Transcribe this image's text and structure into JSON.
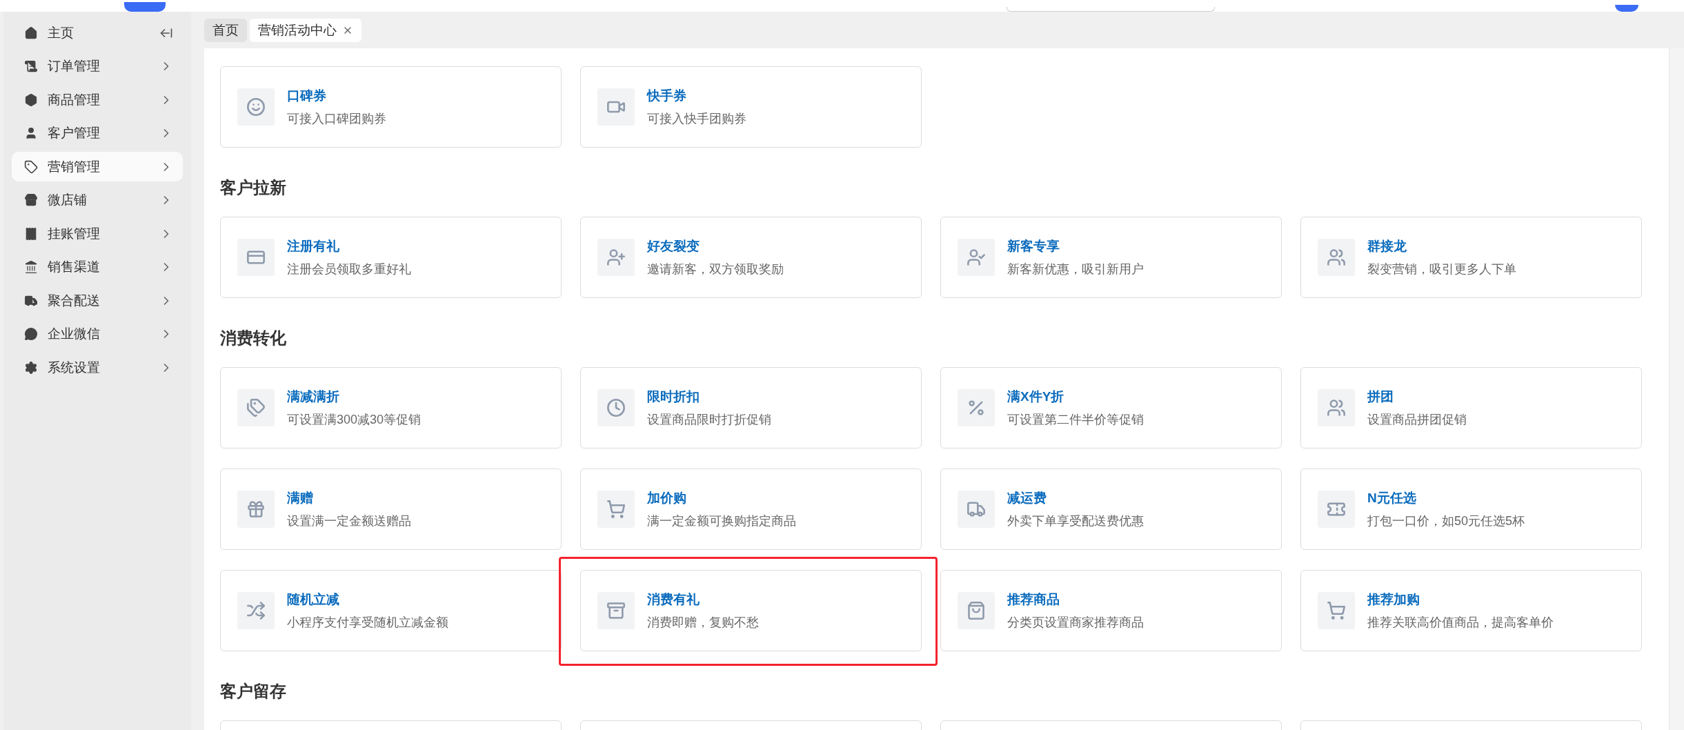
{
  "sidebar": {
    "items": [
      {
        "label": "主页",
        "selected": false,
        "kind": "home"
      },
      {
        "label": "订单管理",
        "selected": false,
        "kind": "menu"
      },
      {
        "label": "商品管理",
        "selected": false,
        "kind": "menu"
      },
      {
        "label": "客户管理",
        "selected": false,
        "kind": "menu"
      },
      {
        "label": "营销管理",
        "selected": true,
        "kind": "menu"
      },
      {
        "label": "微店铺",
        "selected": false,
        "kind": "menu"
      },
      {
        "label": "挂账管理",
        "selected": false,
        "kind": "menu"
      },
      {
        "label": "销售渠道",
        "selected": false,
        "kind": "menu"
      },
      {
        "label": "聚合配送",
        "selected": false,
        "kind": "menu"
      },
      {
        "label": "企业微信",
        "selected": false,
        "kind": "menu"
      },
      {
        "label": "系统设置",
        "selected": false,
        "kind": "menu"
      }
    ]
  },
  "tabs": [
    {
      "label": "首页",
      "selected": false,
      "closable": false
    },
    {
      "label": "营销活动中心",
      "selected": true,
      "closable": true
    }
  ],
  "sections": [
    {
      "cards": [
        {
          "title": "口碑券",
          "description": "可接入口碑团购券"
        },
        {
          "title": "快手券",
          "description": "可接入快手团购券"
        }
      ]
    },
    {
      "title": "客户拉新",
      "cards": [
        {
          "title": "注册有礼",
          "description": "注册会员领取多重好礼"
        },
        {
          "title": "好友裂变",
          "description": "邀请新客，双方领取奖励"
        },
        {
          "title": "新客专享",
          "description": "新客新优惠，吸引新用户"
        },
        {
          "title": "群接龙",
          "description": "裂变营销，吸引更多人下单"
        }
      ]
    },
    {
      "title": "消费转化",
      "cards": [
        {
          "title": "满减满折",
          "description": "可设置满300减30等促销"
        },
        {
          "title": "限时折扣",
          "description": "设置商品限时打折促销"
        },
        {
          "title": "满X件Y折",
          "description": "可设置第二件半价等促销"
        },
        {
          "title": "拼团",
          "description": "设置商品拼团促销"
        },
        {
          "title": "满赠",
          "description": "设置满一定金额送赠品"
        },
        {
          "title": "加价购",
          "description": "满一定金额可换购指定商品"
        },
        {
          "title": "减运费",
          "description": "外卖下单享受配送费优惠"
        },
        {
          "title": "N元任选",
          "description": "打包一口价，如50元任选5杯"
        },
        {
          "title": "随机立减",
          "description": "小程序支付享受随机立减金额"
        },
        {
          "title": "消费有礼",
          "description": "消费即赠，复购不愁",
          "highlighted": true
        },
        {
          "title": "推荐商品",
          "description": "分类页设置商家推荐商品"
        },
        {
          "title": "推荐加购",
          "description": "推荐关联高价值商品，提高客单价"
        }
      ]
    },
    {
      "title": "客户留存",
      "cards": [
        {
          "kind": "cut_off"
        },
        {
          "kind": "cut_off"
        },
        {
          "kind": "cut_off"
        },
        {
          "kind": "cut_off"
        }
      ]
    }
  ]
}
